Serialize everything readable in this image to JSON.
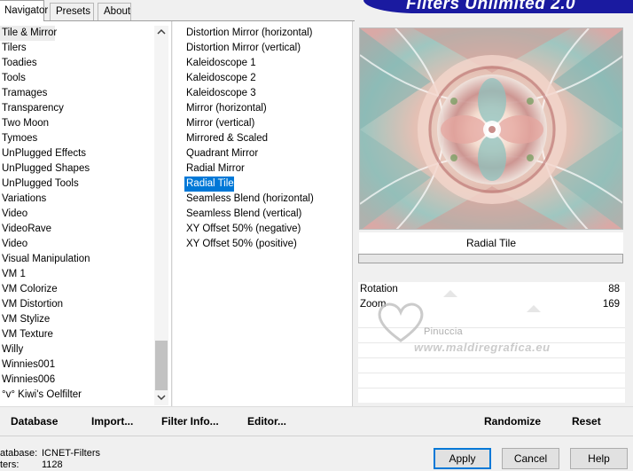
{
  "tabs": [
    "Navigator",
    "Presets",
    "About"
  ],
  "banner_title": "Filters Unlimited 2.0",
  "categories": [
    "Tile & Mirror",
    "Tilers",
    "Toadies",
    "Tools",
    "Tramages",
    "Transparency",
    "Two Moon",
    "Tymoes",
    "UnPlugged Effects",
    "UnPlugged Shapes",
    "UnPlugged Tools",
    "Variations",
    "Video",
    "VideoRave",
    "Video",
    "Visual Manipulation",
    "VM 1",
    "VM Colorize",
    "VM Distortion",
    "VM Stylize",
    "VM Texture",
    "Willy",
    "Winnies001",
    "Winnies006",
    "°v° Kiwi's Oelfilter"
  ],
  "selected_category": "Tile & Mirror",
  "filters": [
    "Distortion Mirror (horizontal)",
    "Distortion Mirror (vertical)",
    "Kaleidoscope 1",
    "Kaleidoscope 2",
    "Kaleidoscope 3",
    "Mirror (horizontal)",
    "Mirror (vertical)",
    "Mirrored & Scaled",
    "Quadrant Mirror",
    "Radial Mirror",
    "Radial Tile",
    "Seamless Blend (horizontal)",
    "Seamless Blend (vertical)",
    "XY Offset 50% (negative)",
    "XY Offset 50% (positive)"
  ],
  "selected_filter": "Radial Tile",
  "preview_name": "Radial Tile",
  "params": [
    {
      "label": "Rotation",
      "value": "88"
    },
    {
      "label": "Zoom",
      "value": "169"
    }
  ],
  "watermark": {
    "name": "Pinuccia",
    "url": "www.maldiregrafica.eu"
  },
  "actions": {
    "database": "Database",
    "import": "Import...",
    "filter_info": "Filter Info...",
    "editor": "Editor...",
    "randomize": "Randomize",
    "reset": "Reset"
  },
  "footer": {
    "database_label": "atabase:",
    "database_value": "ICNET-Filters",
    "filters_label": "ters:",
    "filters_value": "1128",
    "apply": "Apply",
    "cancel": "Cancel",
    "help": "Help"
  },
  "colors": {
    "selection": "#0078d7",
    "banner": "#1a1aa0"
  },
  "icons": {
    "scroll_up": "chevron-up-icon",
    "scroll_down": "chevron-down-icon"
  }
}
